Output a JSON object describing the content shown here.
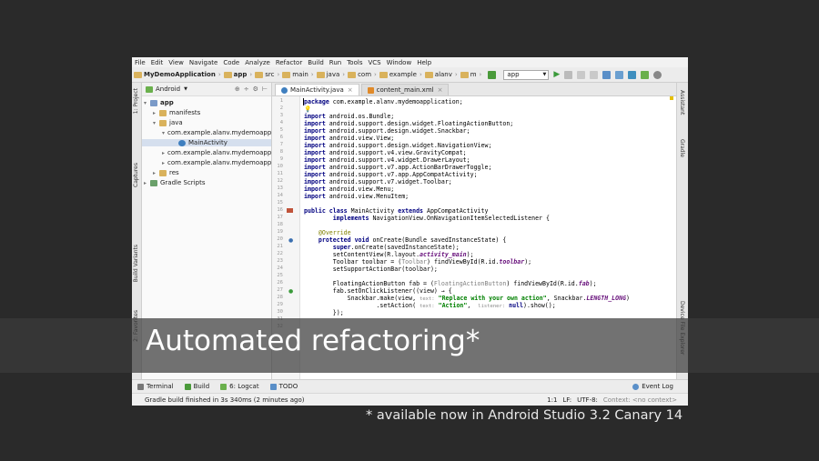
{
  "menu": [
    "File",
    "Edit",
    "View",
    "Navigate",
    "Code",
    "Analyze",
    "Refactor",
    "Build",
    "Run",
    "Tools",
    "VCS",
    "Window",
    "Help"
  ],
  "breadcrumbs": [
    "MyDemoApplication",
    "app",
    "src",
    "main",
    "java",
    "com",
    "example",
    "alanv",
    "m"
  ],
  "run_config": "app",
  "left_tool_windows": [
    "1: Project",
    "Captures",
    "Build Variants",
    "2: Favorites"
  ],
  "right_tool_windows": [
    "Assistant",
    "Gradle",
    "Device File Explorer"
  ],
  "project": {
    "view_mode": "Android",
    "tree": [
      {
        "label": "app"
      },
      {
        "label": "manifests"
      },
      {
        "label": "java"
      },
      {
        "label": "com.example.alanv.mydemoapplication"
      },
      {
        "label": "MainActivity"
      },
      {
        "label": "com.example.alanv.mydemoapplication (androidTest)"
      },
      {
        "label": "com.example.alanv.mydemoapplication (test)"
      },
      {
        "label": "res"
      },
      {
        "label": "Gradle Scripts"
      }
    ]
  },
  "editor_tabs": [
    {
      "label": "MainActivity.java"
    },
    {
      "label": "content_main.xml"
    }
  ],
  "line_numbers": [
    "1",
    "2",
    "3",
    "4",
    "5",
    "6",
    "7",
    "8",
    "9",
    "10",
    "11",
    "12",
    "13",
    "14",
    "15",
    "16",
    "17",
    "18",
    "19",
    "20",
    "21",
    "22",
    "23",
    "24",
    "25",
    "26",
    "27",
    "28",
    "29",
    "30",
    "31",
    "32"
  ],
  "code": {
    "l1": "com.example.alanv.mydemoapplication;",
    "imports": [
      "android.os.Bundle;",
      "android.support.design.widget.FloatingActionButton;",
      "android.support.design.widget.Snackbar;",
      "android.view.View;",
      "android.support.design.widget.NavigationView;",
      "android.support.v4.view.GravityCompat;",
      "android.support.v4.widget.DrawerLayout;",
      "android.support.v7.app.ActionBarDrawerToggle;",
      "android.support.v7.app.AppCompatActivity;",
      "android.support.v7.widget.Toolbar;",
      "android.view.Menu;",
      "android.view.MenuItem;"
    ],
    "class_decl": "MainActivity",
    "extends_name": "AppCompatActivity",
    "implements_name": "NavigationView.OnNavigationItemSelectedListener {",
    "override": "@Override",
    "oncreate": "onCreate(Bundle savedInstanceState) {",
    "super_call": ".onCreate(savedInstanceState);",
    "set_content": "setContentView(R.layout.",
    "layout_name": "activity_main",
    "toolbar_line_a": "Toolbar toolbar = (",
    "toolbar_cast": "Toolbar",
    "toolbar_line_b": ") findViewById(R.id.",
    "toolbar_id": "toolbar",
    "support_action": "setSupportActionBar(toolbar);",
    "fab_line_a": "FloatingActionButton fab = (",
    "fab_cast": "FloatingActionButton",
    "fab_line_b": ") findViewById(R.id.",
    "fab_id": "fab",
    "fab_listener": "fab.setOnClickListener((view) → {",
    "snackbar_a": "Snackbar.make(view,",
    "snackbar_hint": "text:",
    "snackbar_str": "\"Replace with your own action\"",
    "snackbar_b": ", Snackbar.",
    "snackbar_const": "LENGTH_LONG",
    "snackbar_c": ")",
    "setaction_a": ".setAction(",
    "setaction_hint1": "text:",
    "setaction_str": "\"Action\"",
    "setaction_hint2": "listener:",
    "setaction_null": "null",
    "setaction_b": ").show();",
    "close": "});"
  },
  "bottom_tools": [
    "Terminal",
    "Build",
    "6: Logcat",
    "TODO"
  ],
  "event_log": "Event Log",
  "status": {
    "message": "Gradle build finished in 3s 340ms (2 minutes ago)",
    "position": "1:1",
    "line_sep": "LF:",
    "encoding": "UTF-8:",
    "context": "Context: <no context>"
  },
  "overlay_title": "Automated refactoring*",
  "footnote": "* available now in Android Studio 3.2 Canary 14"
}
